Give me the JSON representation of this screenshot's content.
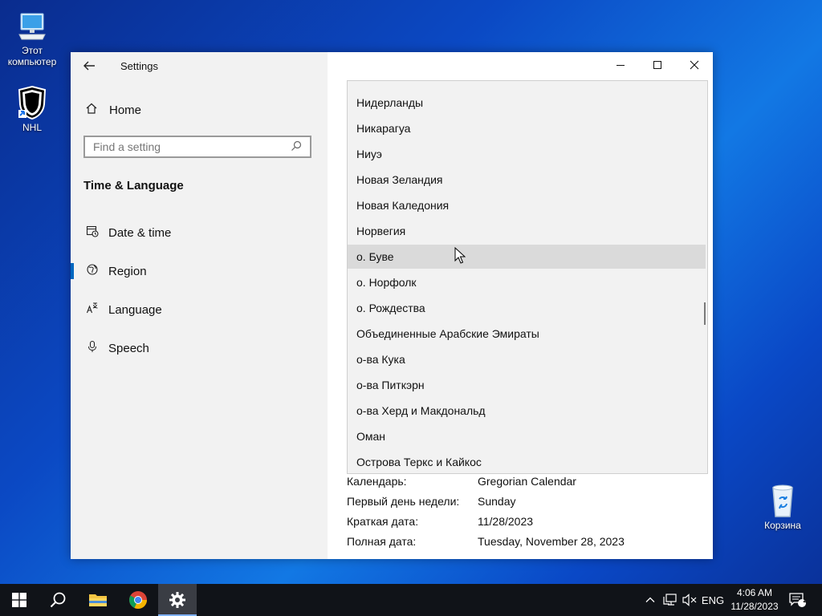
{
  "desktop": {
    "icons": [
      {
        "label": "Этот компьютер"
      },
      {
        "label": "NHL"
      },
      {
        "label": "Корзина"
      }
    ]
  },
  "window": {
    "title": "Settings",
    "home_label": "Home",
    "search_placeholder": "Find a setting",
    "section_title": "Time & Language",
    "nav": [
      {
        "label": "Date & time",
        "icon": "calendar-clock-icon"
      },
      {
        "label": "Region",
        "icon": "globe-icon",
        "selected": true
      },
      {
        "label": "Language",
        "icon": "language-icon"
      },
      {
        "label": "Speech",
        "icon": "microphone-icon"
      }
    ],
    "controls": {
      "minimize": "—",
      "maximize": "☐",
      "close": "✕"
    }
  },
  "dropdown": {
    "items": [
      "Нидерланды",
      "Никарагуа",
      "Ниуэ",
      "Новая Зеландия",
      "Новая Каледония",
      "Норвегия",
      "о. Буве",
      "о. Норфолк",
      "о. Рождества",
      "Объединенные Арабские Эмираты",
      "о-ва Кука",
      "о-ва Питкэрн",
      "о-ва Херд и Макдональд",
      "Оман",
      "Острова Теркс и Кайкос"
    ],
    "hovered": "о. Буве"
  },
  "regional_format": [
    {
      "key": "Календарь:",
      "value": "Gregorian Calendar"
    },
    {
      "key": "Первый день недели:",
      "value": "Sunday"
    },
    {
      "key": "Краткая дата:",
      "value": "11/28/2023"
    },
    {
      "key": "Полная дата:",
      "value": "Tuesday, November 28, 2023"
    }
  ],
  "taskbar": {
    "language": "ENG",
    "time": "4:06 AM",
    "date": "11/28/2023",
    "notification_count": "2"
  },
  "colors": {
    "accent": "#0067c0",
    "hover_item": "#dadada",
    "taskbar": "#101318"
  }
}
